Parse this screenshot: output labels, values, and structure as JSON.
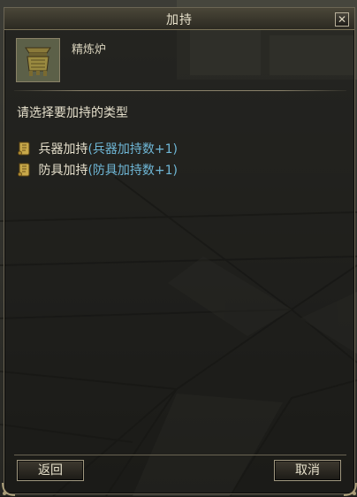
{
  "window": {
    "title": "加持",
    "close_label": "✕"
  },
  "item": {
    "name": "精炼炉",
    "icon": "incense-burner-icon"
  },
  "prompt": "请选择要加持的类型",
  "options": [
    {
      "label": "兵器加持",
      "note": "(兵器加持数+1)",
      "icon": "scroll-icon"
    },
    {
      "label": "防具加持",
      "note": "(防具加持数+1)",
      "icon": "scroll-icon"
    }
  ],
  "buttons": {
    "back": "返回",
    "cancel": "取消"
  },
  "colors": {
    "option_note": "#6fb7d6",
    "text": "#e6e0cc",
    "frame": "#8a826a"
  }
}
